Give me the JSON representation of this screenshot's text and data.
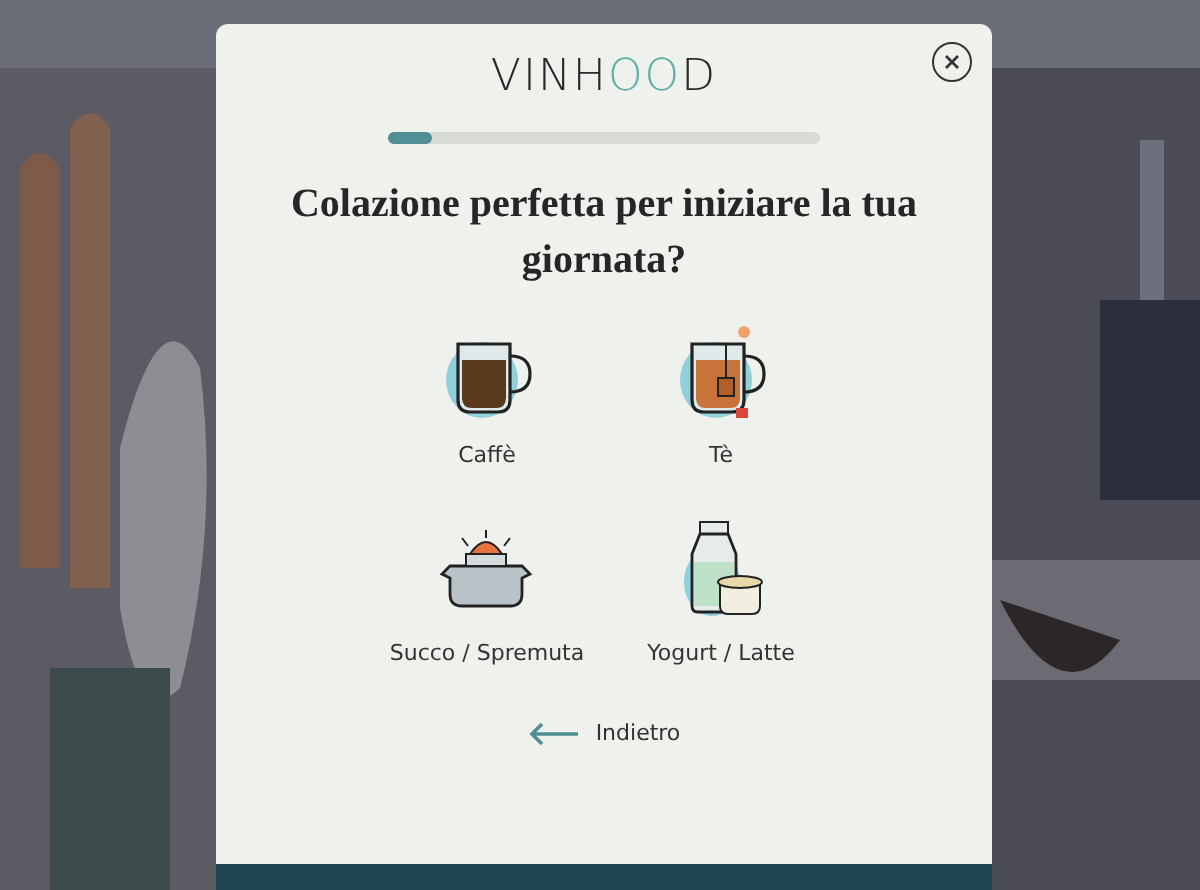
{
  "modal": {
    "logo": "VINHOOD",
    "progress": {
      "level": 0.1
    },
    "question": "Colazione perfetta per iniziare la tua giornata?",
    "options": [
      {
        "label": "Caffè",
        "kind": "coffee"
      },
      {
        "label": "Tè",
        "kind": "tea"
      },
      {
        "label": "Succo / Spremuta",
        "kind": "juice"
      },
      {
        "label": "Yogurt / Latte",
        "kind": "milk"
      }
    ],
    "back": {
      "label": "Indietro"
    }
  }
}
